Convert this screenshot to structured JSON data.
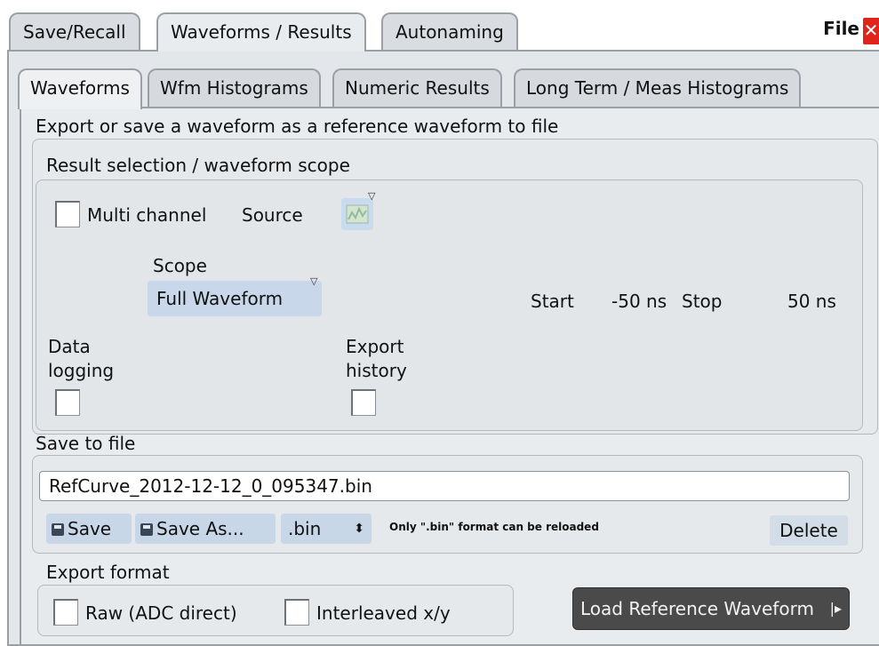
{
  "top_tabs": [
    "Save/Recall",
    "Waveforms / Results",
    "Autonaming"
  ],
  "file_label": "File",
  "sub_tabs": [
    "Waveforms",
    "Wfm Histograms",
    "Numeric Results",
    "Long Term / Meas Histograms"
  ],
  "section_title": "Export or save a waveform as a reference waveform to file",
  "result_group": {
    "title": "Result selection / waveform scope",
    "multi_channel_label": "Multi channel",
    "source_label": "Source",
    "scope_label": "Scope",
    "scope_value": "Full Waveform",
    "start_label": "Start",
    "start_value": "-50 ns",
    "stop_label": "Stop",
    "stop_value": "50 ns",
    "data_logging_line1": "Data",
    "data_logging_line2": "logging",
    "export_history_line1": "Export",
    "export_history_line2": "history"
  },
  "save_group": {
    "title": "Save to file",
    "filename": "RefCurve_2012-12-12_0_095347.bin",
    "save_label": "Save",
    "save_as_label": "Save As...",
    "format_value": ".bin",
    "format_note": "Only \".bin\" format can be reloaded",
    "delete_label": "Delete"
  },
  "export_group": {
    "title": "Export format",
    "raw_label": "Raw (ADC direct)",
    "interleaved_label": "Interleaved x/y"
  },
  "load_button_label": "Load Reference Waveform",
  "colors": {
    "accent_button": "#c8d7e8",
    "close_red": "#e0241b",
    "load_button_bg": "#4a4a4a"
  }
}
